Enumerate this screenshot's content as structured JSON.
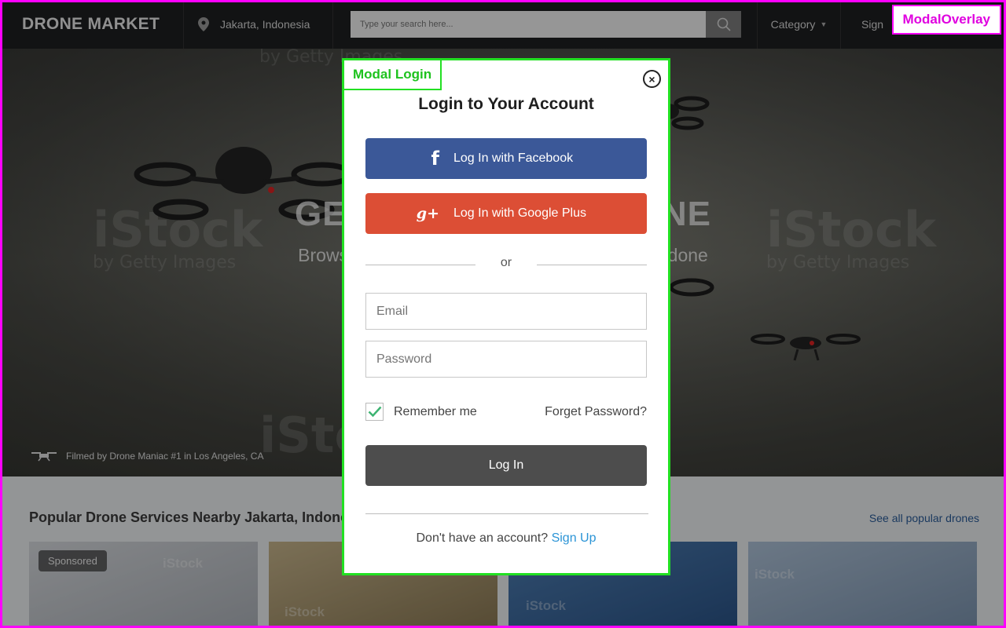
{
  "navbar": {
    "brand": "DRONE MARKET",
    "location": "Jakarta, Indonesia",
    "search_placeholder": "Type your search here...",
    "category_label": "Category",
    "signin_label": "Sign"
  },
  "hero": {
    "title": "GET THE RIGHT DRONE",
    "subtitle": "Browse hundreds of drones to get your things done",
    "credit": "Filmed by Drone Maniac #1 in Los Angeles, CA",
    "watermark_main": "iStock",
    "watermark_sub": "by Getty Images"
  },
  "popular": {
    "title": "Popular Drone Services Nearby Jakarta, Indonesia",
    "see_all": "See all popular drones",
    "cards": [
      {
        "badge": "Sponsored",
        "color": "#c9ccd1"
      },
      {
        "badge": "",
        "color": "#b7a27a"
      },
      {
        "badge": "",
        "color": "#3f6fa6"
      },
      {
        "badge": "",
        "color": "#9fb5cc"
      }
    ]
  },
  "overlay": {
    "tag": "ModalOverlay"
  },
  "modal": {
    "tag": "Modal Login",
    "close_symbol": "×",
    "title": "Login to Your Account",
    "facebook_icon": "f",
    "facebook_label": "Log In with Facebook",
    "google_icon": "g+",
    "google_label": "Log In with Google Plus",
    "divider_text": "or",
    "email_placeholder": "Email",
    "password_placeholder": "Password",
    "remember_label": "Remember me",
    "remember_checked": true,
    "forgot_label": "Forget Password?",
    "login_label": "Log In",
    "signup_prompt": "Don't have an account?",
    "signup_link": "Sign Up"
  },
  "colors": {
    "facebook": "#3b5898",
    "google": "#dc4e35",
    "login_button": "#4d4d4d",
    "link": "#2b94d6",
    "overlay_border": "#ff00ff",
    "modal_border": "#22e022"
  }
}
